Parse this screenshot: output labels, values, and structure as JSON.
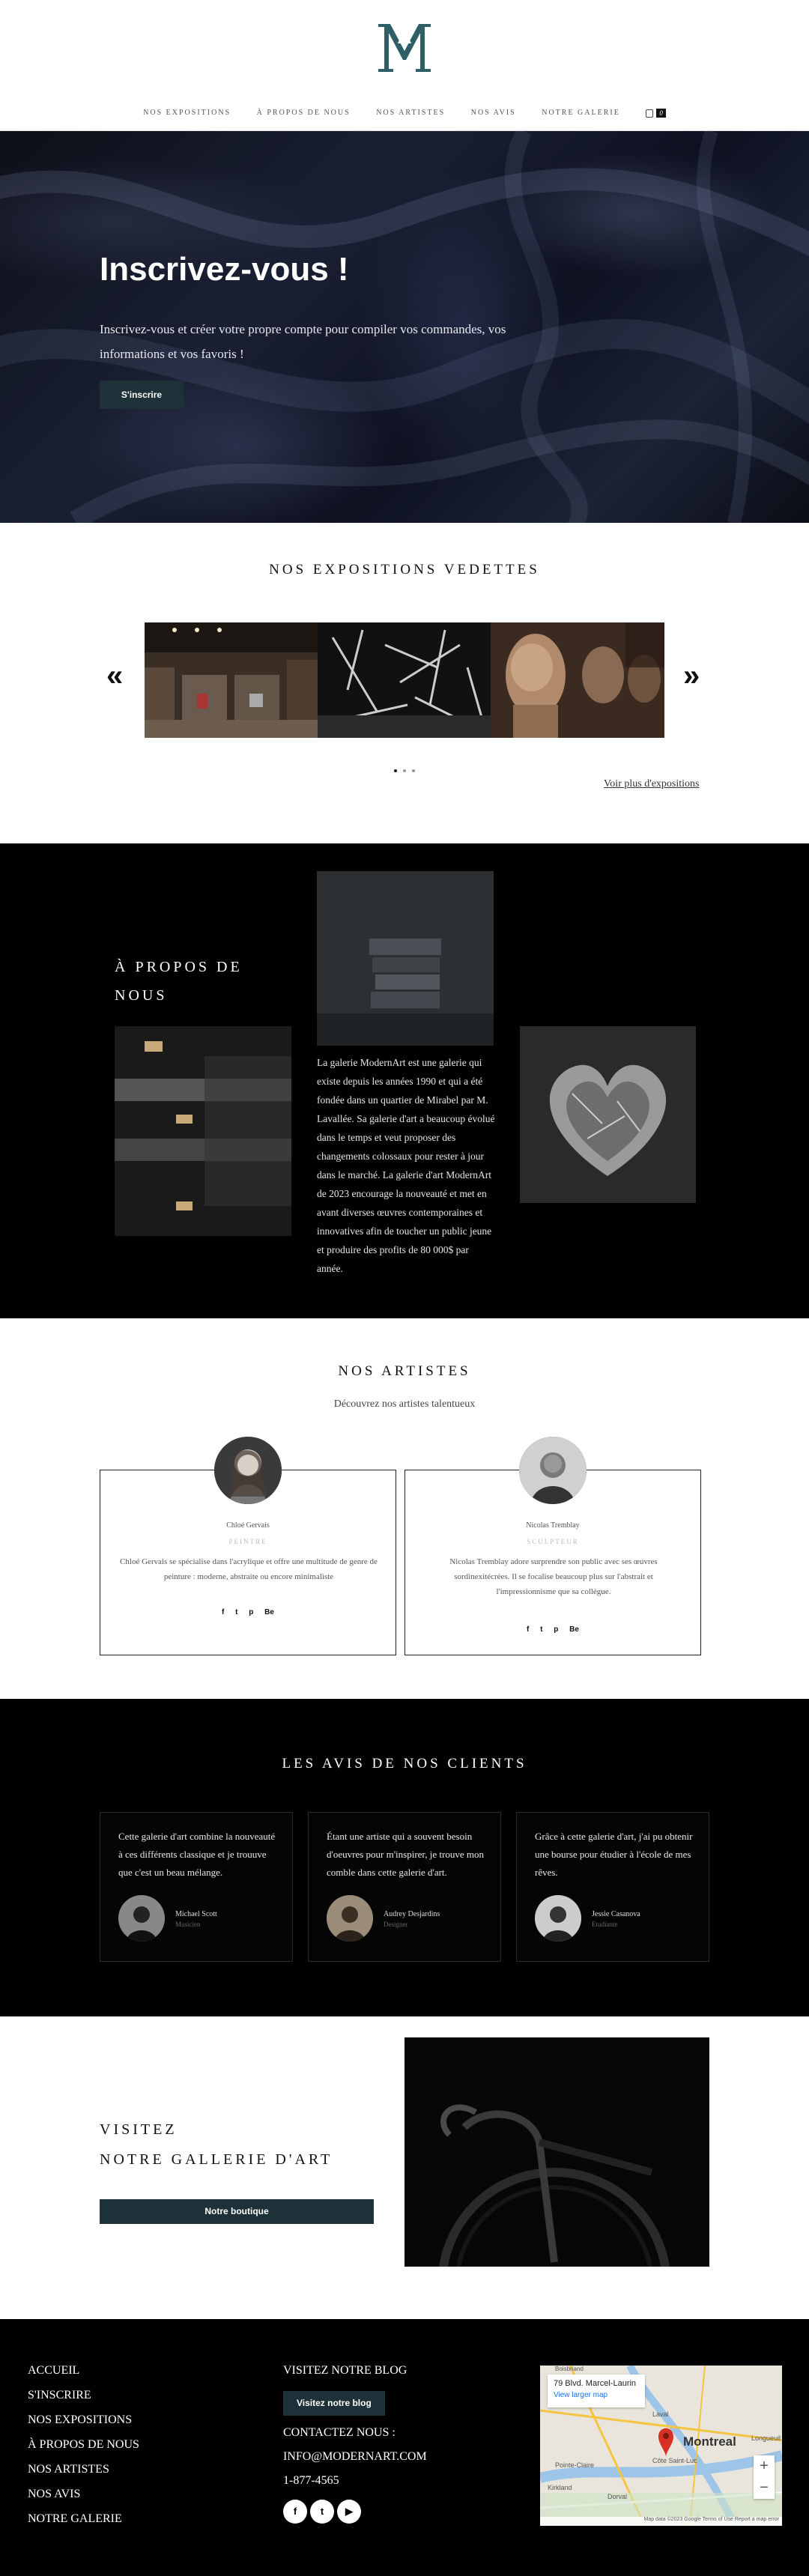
{
  "colors": {
    "accent": "#1e3038",
    "logo": "#2f5f66",
    "dark": "#000000",
    "light": "#ffffff"
  },
  "header": {
    "logo_icon": "ma-monogram-logo",
    "nav": [
      "NOS EXPOSITIONS",
      "À PROPOS DE NOUS",
      "NOS ARTISTES",
      "NOS AVIS",
      "NOTRE GALERIE"
    ],
    "cart_icon": "shopping-bag-icon",
    "cart_count": "0"
  },
  "hero": {
    "title": "Inscrivez-vous !",
    "text": "Inscrivez-vous et créer votre propre compte pour compiler vos commandes, vos informations et vos favoris !",
    "button": "S'inscrire"
  },
  "exhibitions": {
    "title": "NOS EXPOSITIONS VEDETTES",
    "prev": "«",
    "next": "»",
    "more": "Voir plus d'expositions"
  },
  "about": {
    "title": "À PROPOS DE NOUS",
    "text": "La galerie ModernArt est une galerie qui existe depuis les années 1990 et qui a été fondée dans un quartier de Mirabel par M. Lavallée. Sa galerie d'art a beaucoup évolué dans le temps et veut proposer des changements colossaux pour rester à jour dans le marché. La galerie d'art ModernArt de 2023 encourage la nouveauté et met en avant diverses œuvres contemporaines et innovatives afin de toucher un public jeune et produire des profits de 80 000$ par année."
  },
  "artists": {
    "title": "NOS ARTISTES",
    "subtitle": "Découvrez nos artistes talentueux",
    "cards": [
      {
        "name": "Chloé Gervais",
        "role": "PEINTRE",
        "bio": "Chloé Gervais se spécialise dans l'acrylique et offre une multitude de genre de peinture : moderne, abstraite ou encore minimaliste"
      },
      {
        "name": "Nicolas Tremblay",
        "role": "SCULPTEUR",
        "bio": "Nicolas Tremblay adore surprendre son public avec ses œuvres sordinexitécrées. Il se focalise beaucoup plus sur l'abstrait et l'impressionnisme que sa collègue."
      }
    ],
    "socials": [
      "f",
      "t",
      "p",
      "Be"
    ]
  },
  "reviews": {
    "title": "LES AVIS DE NOS CLIENTS",
    "items": [
      {
        "quote": "Cette galerie d'art combine la nouveauté à ces différents classique et je trouuve que c'est un beau mélange.",
        "name": "Michael Scott",
        "role": "Musicien"
      },
      {
        "quote": "Étant une artiste qui a souvent besoin d'oeuvres pour m'inspirer, je trouve mon comble dans cette galerie d'art.",
        "name": "Audrey Desjardins",
        "role": "Designer"
      },
      {
        "quote": "Grâce à cette galerie d'art, j'ai pu obtenir une bourse pour étudier à l'école de mes rêves.",
        "name": "Jessie Casanova",
        "role": "Etudiante"
      }
    ]
  },
  "visit": {
    "line1": "VISITEZ",
    "line2": "NOTRE GALLERIE D'ART",
    "button": "Notre boutique"
  },
  "footer": {
    "links": [
      "ACCUEIL",
      "S'INSCRIRE",
      "NOS EXPOSITIONS",
      "À PROPOS DE NOUS",
      "NOS ARTISTES",
      "NOS AVIS",
      "NOTRE GALERIE"
    ],
    "blog_title": "VISITEZ NOTRE BLOG",
    "blog_button": "Visitez notre blog",
    "contact_title": "CONTACTEZ NOUS :",
    "email": "INFO@MODERNART.COM",
    "phone": "1-877-4565",
    "social_icons": [
      "facebook-icon",
      "twitter-icon",
      "youtube-icon"
    ],
    "map": {
      "address": "79 Blvd. Marcel-Laurin",
      "link": "View larger map",
      "city": "Montreal",
      "places": [
        "Boisbriand",
        "Laval",
        "Pointe-Claire",
        "Côte Saint-Luc",
        "Kirkland",
        "Dorval",
        "Longueuil"
      ],
      "attribution": "Map data ©2023 Google   Terms of Use   Report a map error"
    }
  }
}
